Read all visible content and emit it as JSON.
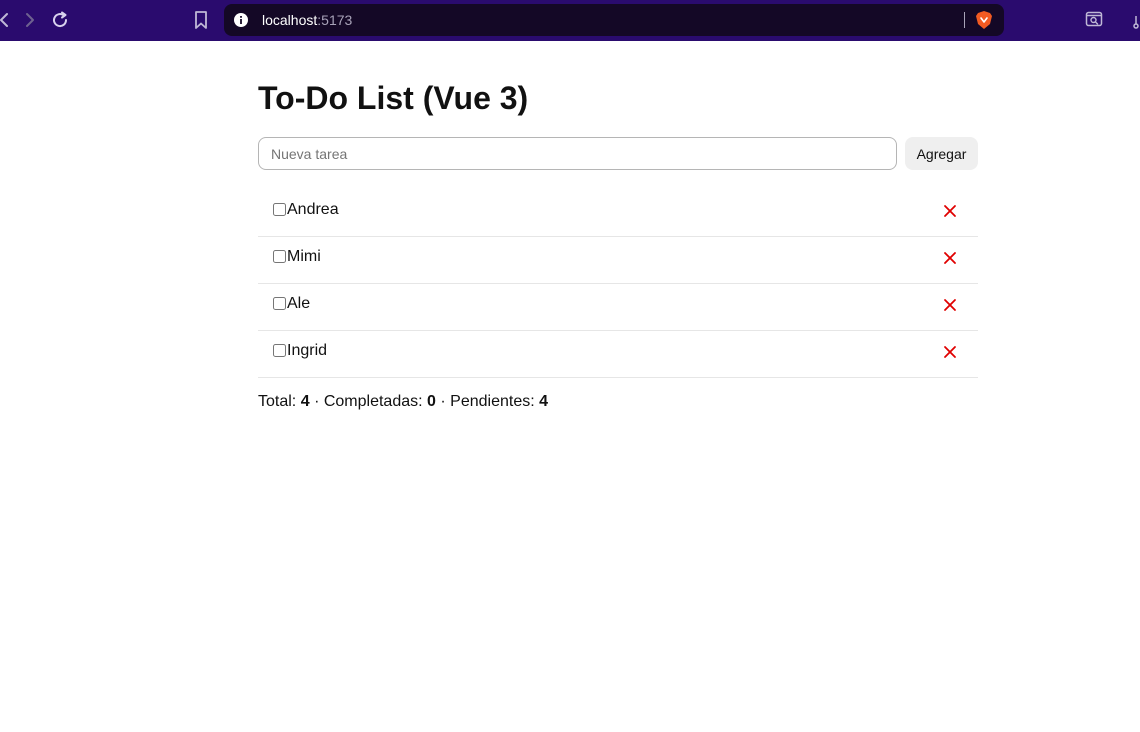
{
  "browser": {
    "url_host": "localhost",
    "url_port": ":5173"
  },
  "app": {
    "title": "To-Do List (Vue 3)",
    "input_placeholder": "Nueva tarea",
    "input_value": "",
    "add_label": "Agregar",
    "delete_symbol": "✕",
    "tasks": [
      {
        "text": "Andrea",
        "done": false
      },
      {
        "text": "Mimi",
        "done": false
      },
      {
        "text": "Ale",
        "done": false
      },
      {
        "text": "Ingrid",
        "done": false
      }
    ],
    "summary": {
      "total_label": "Total:",
      "total": "4",
      "sep1": "·",
      "completed_label": "Completadas:",
      "completed": "0",
      "sep2": "·",
      "pending_label": "Pendientes:",
      "pending": "4"
    }
  },
  "colors": {
    "toolbar": "#2a0b6e",
    "urlbar": "#140826",
    "delete": "#e00000"
  }
}
